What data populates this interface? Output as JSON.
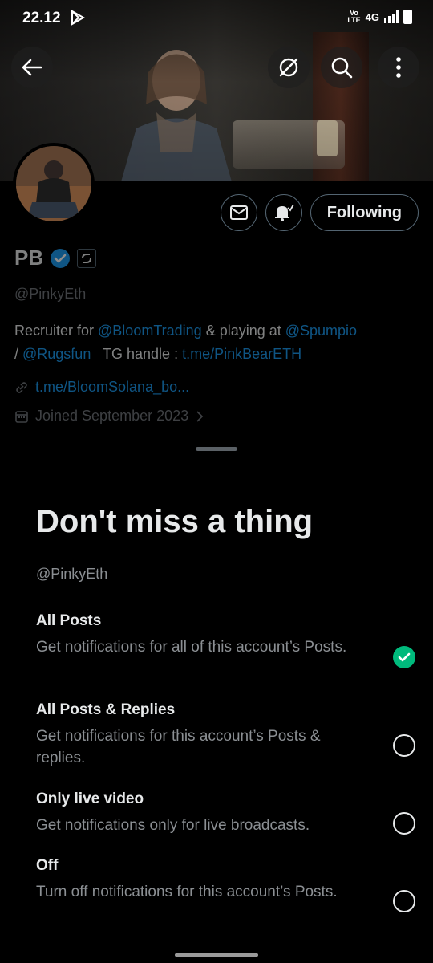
{
  "status_bar": {
    "time": "22.12",
    "volte": "Vo\nLTE",
    "network": "4G"
  },
  "profile": {
    "display_name": "PB",
    "handle": "@PinkyEth",
    "following_label": "Following",
    "bio": {
      "text_1": "Recruiter for ",
      "mention_1": "@BloomTrading",
      "text_2": " & playing at ",
      "mention_2": "@Spumpio",
      "text_3": " / ",
      "mention_3": "@Rugsfun",
      "text_4": "   TG handle : ",
      "link_1": "t.me/PinkBearETH"
    },
    "website": "t.me/BloomSolana_bo...",
    "joined": "Joined September 2023"
  },
  "sheet": {
    "title": "Don't miss a thing",
    "handle": "@PinkyEth",
    "options": [
      {
        "title": "All Posts",
        "desc": "Get notifications for all of this account’s Posts.",
        "selected": true
      },
      {
        "title": "All Posts & Replies",
        "desc": "Get notifications for this account’s Posts & replies.",
        "selected": false
      },
      {
        "title": "Only live video",
        "desc": "Get notifications only for live broadcasts.",
        "selected": false
      },
      {
        "title": "Off",
        "desc": "Turn off notifications for this account’s Posts.",
        "selected": false
      }
    ]
  },
  "colors": {
    "accent_link": "#1d9bf0",
    "selected_green": "#00ba7c",
    "verified_blue": "#1d9bf0",
    "background": "#000000"
  }
}
